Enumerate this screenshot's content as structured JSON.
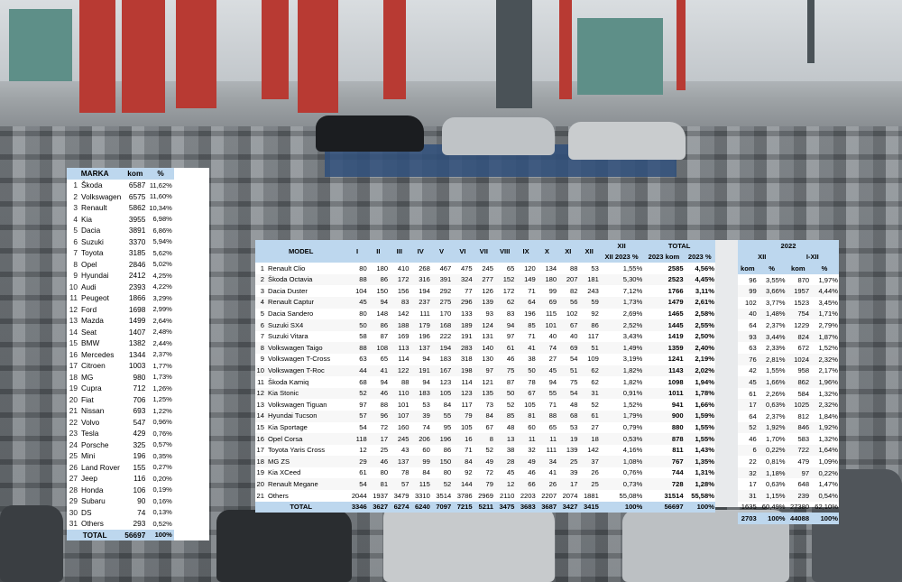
{
  "marka": {
    "headers": [
      "MARKA",
      "kom",
      "%"
    ],
    "rows": [
      [
        "1",
        "Škoda",
        "6587",
        "11,62%"
      ],
      [
        "2",
        "Volkswagen",
        "6575",
        "11,60%"
      ],
      [
        "3",
        "Renault",
        "5862",
        "10,34%"
      ],
      [
        "4",
        "Kia",
        "3955",
        "6,98%"
      ],
      [
        "5",
        "Dacia",
        "3891",
        "6,86%"
      ],
      [
        "6",
        "Suzuki",
        "3370",
        "5,94%"
      ],
      [
        "7",
        "Toyota",
        "3185",
        "5,62%"
      ],
      [
        "8",
        "Opel",
        "2846",
        "5,02%"
      ],
      [
        "9",
        "Hyundai",
        "2412",
        "4,25%"
      ],
      [
        "10",
        "Audi",
        "2393",
        "4,22%"
      ],
      [
        "11",
        "Peugeot",
        "1866",
        "3,29%"
      ],
      [
        "12",
        "Ford",
        "1698",
        "2,99%"
      ],
      [
        "13",
        "Mazda",
        "1499",
        "2,64%"
      ],
      [
        "14",
        "Seat",
        "1407",
        "2,48%"
      ],
      [
        "15",
        "BMW",
        "1382",
        "2,44%"
      ],
      [
        "16",
        "Mercedes",
        "1344",
        "2,37%"
      ],
      [
        "17",
        "Citroen",
        "1003",
        "1,77%"
      ],
      [
        "18",
        "MG",
        "980",
        "1,73%"
      ],
      [
        "19",
        "Cupra",
        "712",
        "1,26%"
      ],
      [
        "20",
        "Fiat",
        "706",
        "1,25%"
      ],
      [
        "21",
        "Nissan",
        "693",
        "1,22%"
      ],
      [
        "22",
        "Volvo",
        "547",
        "0,96%"
      ],
      [
        "23",
        "Tesla",
        "429",
        "0,76%"
      ],
      [
        "24",
        "Porsche",
        "325",
        "0,57%"
      ],
      [
        "25",
        "Mini",
        "196",
        "0,35%"
      ],
      [
        "26",
        "Land Rover",
        "155",
        "0,27%"
      ],
      [
        "27",
        "Jeep",
        "116",
        "0,20%"
      ],
      [
        "28",
        "Honda",
        "106",
        "0,19%"
      ],
      [
        "29",
        "Subaru",
        "90",
        "0,16%"
      ],
      [
        "30",
        "DS",
        "74",
        "0,13%"
      ],
      [
        "31",
        "Others",
        "293",
        "0,52%"
      ]
    ],
    "total": [
      "TOTAL",
      "56697",
      "100%"
    ]
  },
  "model": {
    "header_top": [
      "XII",
      "TOTAL",
      ""
    ],
    "headers": [
      "MODEL",
      "I",
      "II",
      "III",
      "IV",
      "V",
      "VI",
      "VII",
      "VIII",
      "IX",
      "X",
      "XI",
      "XII",
      "XII 2023 %",
      "2023 kom",
      "2023 %"
    ],
    "rows": [
      [
        "1",
        "Renault Clio",
        "80",
        "180",
        "410",
        "268",
        "467",
        "475",
        "245",
        "65",
        "120",
        "134",
        "88",
        "53",
        "1,55%",
        "2585",
        "4,56%"
      ],
      [
        "2",
        "Škoda Octavia",
        "88",
        "86",
        "172",
        "316",
        "391",
        "324",
        "277",
        "152",
        "149",
        "180",
        "207",
        "181",
        "5,30%",
        "2523",
        "4,45%"
      ],
      [
        "3",
        "Dacia Duster",
        "104",
        "150",
        "156",
        "194",
        "292",
        "77",
        "126",
        "172",
        "71",
        "99",
        "82",
        "243",
        "7,12%",
        "1766",
        "3,11%"
      ],
      [
        "4",
        "Renault Captur",
        "45",
        "94",
        "83",
        "237",
        "275",
        "296",
        "139",
        "62",
        "64",
        "69",
        "56",
        "59",
        "1,73%",
        "1479",
        "2,61%"
      ],
      [
        "5",
        "Dacia Sandero",
        "80",
        "148",
        "142",
        "111",
        "170",
        "133",
        "93",
        "83",
        "196",
        "115",
        "102",
        "92",
        "2,69%",
        "1465",
        "2,58%"
      ],
      [
        "6",
        "Suzuki SX4",
        "50",
        "86",
        "188",
        "179",
        "168",
        "189",
        "124",
        "94",
        "85",
        "101",
        "67",
        "86",
        "2,52%",
        "1445",
        "2,55%"
      ],
      [
        "7",
        "Suzuki Vitara",
        "58",
        "87",
        "169",
        "196",
        "222",
        "191",
        "131",
        "97",
        "71",
        "40",
        "40",
        "117",
        "3,43%",
        "1419",
        "2,50%"
      ],
      [
        "8",
        "Volkswagen Taigo",
        "88",
        "108",
        "113",
        "137",
        "194",
        "283",
        "140",
        "61",
        "41",
        "74",
        "69",
        "51",
        "1,49%",
        "1359",
        "2,40%"
      ],
      [
        "9",
        "Volkswagen T-Cross",
        "63",
        "65",
        "114",
        "94",
        "183",
        "318",
        "130",
        "46",
        "38",
        "27",
        "54",
        "109",
        "3,19%",
        "1241",
        "2,19%"
      ],
      [
        "10",
        "Volkswagen T-Roc",
        "44",
        "41",
        "122",
        "191",
        "167",
        "198",
        "97",
        "75",
        "50",
        "45",
        "51",
        "62",
        "1,82%",
        "1143",
        "2,02%"
      ],
      [
        "11",
        "Škoda Kamiq",
        "68",
        "94",
        "88",
        "94",
        "123",
        "114",
        "121",
        "87",
        "78",
        "94",
        "75",
        "62",
        "1,82%",
        "1098",
        "1,94%"
      ],
      [
        "12",
        "Kia Stonic",
        "52",
        "46",
        "110",
        "183",
        "105",
        "123",
        "135",
        "50",
        "67",
        "55",
        "54",
        "31",
        "0,91%",
        "1011",
        "1,78%"
      ],
      [
        "13",
        "Volkswagen Tiguan",
        "97",
        "88",
        "101",
        "53",
        "84",
        "117",
        "73",
        "52",
        "105",
        "71",
        "48",
        "52",
        "1,52%",
        "941",
        "1,66%"
      ],
      [
        "14",
        "Hyundai Tucson",
        "57",
        "96",
        "107",
        "39",
        "55",
        "79",
        "84",
        "85",
        "81",
        "88",
        "68",
        "61",
        "1,79%",
        "900",
        "1,59%"
      ],
      [
        "15",
        "Kia Sportage",
        "54",
        "72",
        "160",
        "74",
        "95",
        "105",
        "67",
        "48",
        "60",
        "65",
        "53",
        "27",
        "0,79%",
        "880",
        "1,55%"
      ],
      [
        "16",
        "Opel Corsa",
        "118",
        "17",
        "245",
        "206",
        "196",
        "16",
        "8",
        "13",
        "11",
        "11",
        "19",
        "18",
        "0,53%",
        "878",
        "1,55%"
      ],
      [
        "17",
        "Toyota Yaris Cross",
        "12",
        "25",
        "43",
        "60",
        "86",
        "71",
        "52",
        "38",
        "32",
        "111",
        "139",
        "142",
        "4,16%",
        "811",
        "1,43%"
      ],
      [
        "18",
        "MG ZS",
        "29",
        "46",
        "137",
        "99",
        "150",
        "84",
        "49",
        "28",
        "49",
        "34",
        "25",
        "37",
        "1,08%",
        "767",
        "1,35%"
      ],
      [
        "19",
        "Kia XCeed",
        "61",
        "80",
        "78",
        "84",
        "80",
        "92",
        "72",
        "45",
        "46",
        "41",
        "39",
        "26",
        "0,76%",
        "744",
        "1,31%"
      ],
      [
        "20",
        "Renault Megane",
        "54",
        "81",
        "57",
        "115",
        "52",
        "144",
        "79",
        "12",
        "66",
        "26",
        "17",
        "25",
        "0,73%",
        "728",
        "1,28%"
      ],
      [
        "21",
        "Others",
        "2044",
        "1937",
        "3479",
        "3310",
        "3514",
        "3786",
        "2969",
        "2110",
        "2203",
        "2207",
        "2074",
        "1881",
        "55,08%",
        "31514",
        "55,58%"
      ]
    ],
    "total": [
      "TOTAL",
      "3346",
      "3627",
      "6274",
      "6240",
      "7097",
      "7215",
      "5211",
      "3475",
      "3683",
      "3687",
      "3427",
      "3415",
      "100%",
      "56697",
      "100%"
    ]
  },
  "y2022": {
    "title": "2022",
    "group_headers": [
      "XII",
      "I-XII"
    ],
    "headers": [
      "kom",
      "%",
      "kom",
      "%"
    ],
    "rows": [
      [
        "96",
        "3,55%",
        "870",
        "1,97%"
      ],
      [
        "99",
        "3,66%",
        "1957",
        "4,44%"
      ],
      [
        "102",
        "3,77%",
        "1523",
        "3,45%"
      ],
      [
        "40",
        "1,48%",
        "754",
        "1,71%"
      ],
      [
        "64",
        "2,37%",
        "1229",
        "2,79%"
      ],
      [
        "93",
        "3,44%",
        "824",
        "1,87%"
      ],
      [
        "63",
        "2,33%",
        "672",
        "1,52%"
      ],
      [
        "76",
        "2,81%",
        "1024",
        "2,32%"
      ],
      [
        "42",
        "1,55%",
        "958",
        "2,17%"
      ],
      [
        "45",
        "1,66%",
        "862",
        "1,96%"
      ],
      [
        "61",
        "2,26%",
        "584",
        "1,32%"
      ],
      [
        "17",
        "0,63%",
        "1025",
        "2,32%"
      ],
      [
        "64",
        "2,37%",
        "812",
        "1,84%"
      ],
      [
        "52",
        "1,92%",
        "846",
        "1,92%"
      ],
      [
        "46",
        "1,70%",
        "583",
        "1,32%"
      ],
      [
        "6",
        "0,22%",
        "722",
        "1,64%"
      ],
      [
        "22",
        "0,81%",
        "479",
        "1,09%"
      ],
      [
        "32",
        "1,18%",
        "97",
        "0,22%"
      ],
      [
        "17",
        "0,63%",
        "648",
        "1,47%"
      ],
      [
        "31",
        "1,15%",
        "239",
        "0,54%"
      ],
      [
        "1635",
        "60,49%",
        "27380",
        "62,10%"
      ]
    ],
    "total": [
      "2703",
      "100%",
      "44088",
      "100%"
    ]
  }
}
